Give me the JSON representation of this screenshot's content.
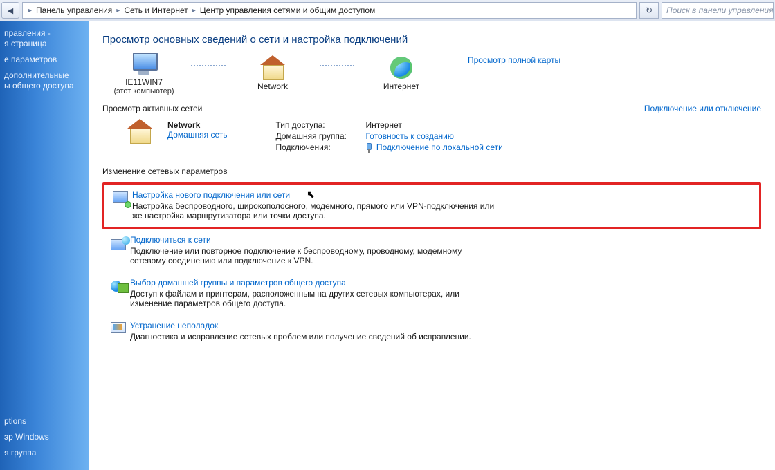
{
  "toolbar": {
    "breadcrumb": [
      "Панель управления",
      "Сеть и Интернет",
      "Центр управления сетями и общим доступом"
    ],
    "search_placeholder": "Поиск в панели управления"
  },
  "sidebar": {
    "items": [
      "правления -\nя страница",
      "е параметров",
      "дополнительные\nы общего доступа"
    ],
    "bottom": [
      "ptions",
      "эр Windows",
      "я группа"
    ]
  },
  "page": {
    "title": "Просмотр основных сведений о сети и настройка подключений",
    "view_full_map": "Просмотр полной карты",
    "nodes": {
      "computer_name": "IE11WIN7",
      "computer_sub": "(этот компьютер)",
      "network_name": "Network",
      "internet_name": "Интернет"
    },
    "active_section_title": "Просмотр активных сетей",
    "connect_disconnect": "Подключение или отключение",
    "active_network": {
      "name": "Network",
      "type_link": "Домашняя сеть",
      "kv": {
        "access_label": "Тип доступа:",
        "access_value": "Интернет",
        "homegroup_label": "Домашняя группа:",
        "homegroup_value": "Готовность к созданию",
        "connections_label": "Подключения:",
        "connection_link": "Подключение по локальной сети"
      }
    },
    "change_settings_header": "Изменение сетевых параметров",
    "tasks": [
      {
        "title": "Настройка нового подключения или сети",
        "desc": "Настройка беспроводного, широкополосного, модемного, прямого или VPN-подключения или же настройка маршрутизатора или точки доступа."
      },
      {
        "title": "Подключиться к сети",
        "desc": "Подключение или повторное подключение к беспроводному, проводному, модемному сетевому соединению или подключение к VPN."
      },
      {
        "title": "Выбор домашней группы и параметров общего доступа",
        "desc": "Доступ к файлам и принтерам, расположенным на других сетевых компьютерах, или изменение параметров общего доступа."
      },
      {
        "title": "Устранение неполадок",
        "desc": "Диагностика и исправление сетевых проблем или получение сведений об исправлении."
      }
    ]
  }
}
